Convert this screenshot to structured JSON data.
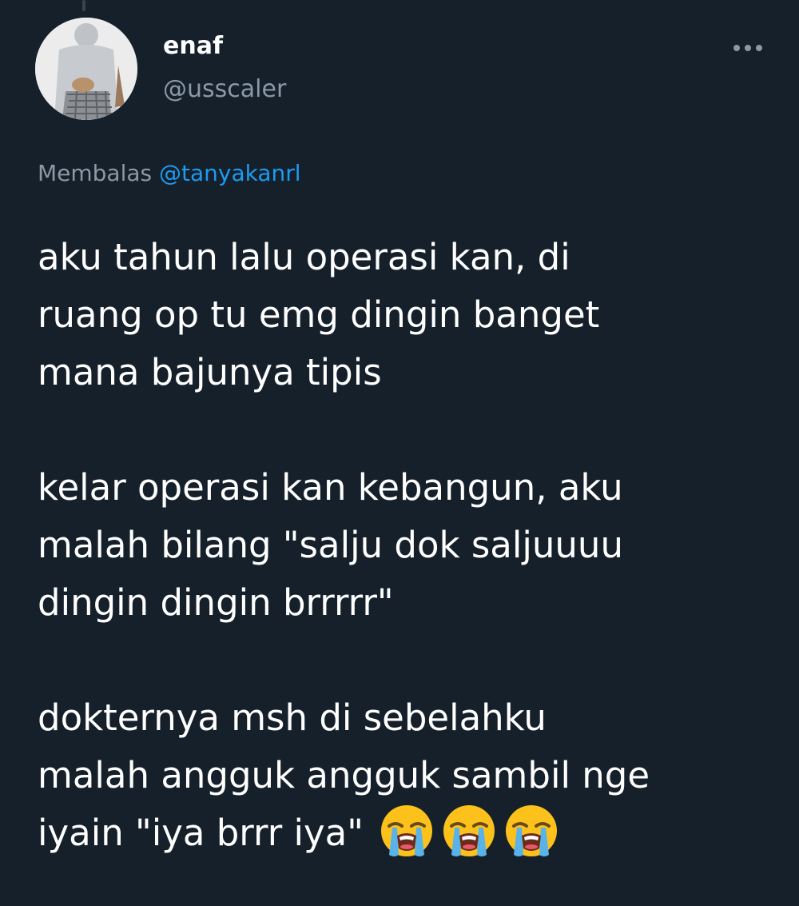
{
  "tweet": {
    "author": {
      "name": "enaf",
      "handle": "@usscaler"
    },
    "reply": {
      "prefix": "Membalas",
      "mention": "@tanyakanrl"
    },
    "paragraphs": [
      [
        "aku tahun lalu operasi kan, di",
        "ruang op tu emg dingin banget",
        "mana bajunya tipis"
      ],
      [
        "kelar operasi kan kebangun, aku",
        "malah bilang \"salju dok saljuuuu",
        "dingin dingin brrrrr\""
      ],
      [
        "dokternya msh di sebelahku",
        "malah angguk angguk sambil nge",
        "iyain \"iya brrr iya\""
      ]
    ],
    "emojis": [
      "loudly-crying-face-icon",
      "loudly-crying-face-icon",
      "loudly-crying-face-icon"
    ]
  },
  "colors": {
    "background": "#15202b",
    "text": "#ffffff",
    "secondary_text": "#8b98a5",
    "link": "#1d9bf0"
  }
}
